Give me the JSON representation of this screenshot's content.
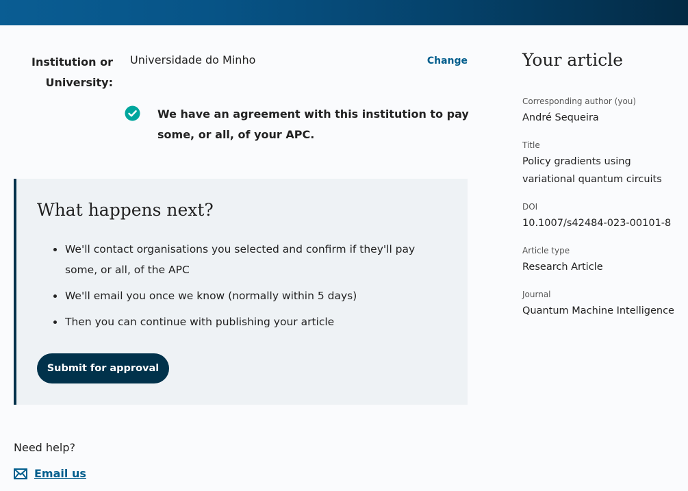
{
  "institution": {
    "label": "Institution or University:",
    "value": "Universidade do Minho",
    "change_label": "Change",
    "agreement_text": "We have an agreement with this institution to pay some, or all, of your APC."
  },
  "next_steps": {
    "heading": "What happens next?",
    "items": [
      "We'll contact organisations you selected and confirm if they'll pay some, or all, of the APC",
      "We'll email you once we know (normally within 5 days)",
      "Then you can continue with publishing your article"
    ],
    "submit_label": "Submit for approval"
  },
  "help": {
    "heading": "Need help?",
    "email_label": "Email us",
    "email_icon": "mail-icon"
  },
  "article": {
    "heading": "Your article",
    "fields": [
      {
        "label": "Corresponding author (you)",
        "value": "André Sequeira"
      },
      {
        "label": "Title",
        "value": "Policy gradients using variational quantum circuits"
      },
      {
        "label": "DOI",
        "value": "10.1007/s42484-023-00101-8"
      },
      {
        "label": "Article type",
        "value": "Research Article"
      },
      {
        "label": "Journal",
        "value": "Quantum Machine Intelligence"
      }
    ]
  },
  "colors": {
    "accent": "#025e8d",
    "dark": "#01324b",
    "success": "#00a69d",
    "panel": "#eef2f5"
  }
}
